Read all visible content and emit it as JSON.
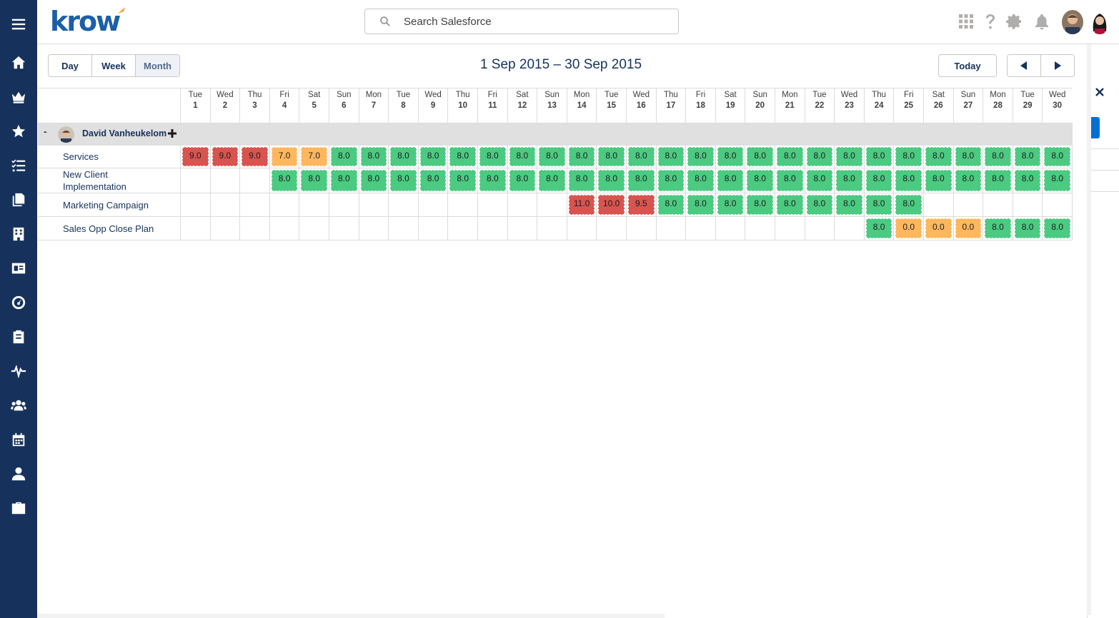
{
  "brand": {
    "logo_text": "krow",
    "accent": "#f59a23",
    "primary": "#1b5fa8"
  },
  "search": {
    "placeholder": "Search Salesforce"
  },
  "sidebar": {
    "items": [
      {
        "icon": "menu-icon"
      },
      {
        "icon": "home-icon"
      },
      {
        "icon": "crown-icon"
      },
      {
        "icon": "star-icon"
      },
      {
        "icon": "task-list-icon"
      },
      {
        "icon": "files-icon"
      },
      {
        "icon": "building-icon"
      },
      {
        "icon": "contact-card-icon"
      },
      {
        "icon": "dashboard-gauge-icon"
      },
      {
        "icon": "clipboard-icon"
      },
      {
        "icon": "pulse-icon"
      },
      {
        "icon": "group-icon"
      },
      {
        "icon": "calendar-icon"
      },
      {
        "icon": "person-icon"
      },
      {
        "icon": "briefcase-icon"
      }
    ]
  },
  "toolbar": {
    "views": [
      "Day",
      "Week",
      "Month"
    ],
    "active_view": "Month",
    "date_range": "1 Sep 2015 – 30 Sep 2015",
    "today_label": "Today"
  },
  "grid": {
    "days": [
      {
        "dow": "Tue",
        "num": "1"
      },
      {
        "dow": "Wed",
        "num": "2"
      },
      {
        "dow": "Thu",
        "num": "3"
      },
      {
        "dow": "Fri",
        "num": "4"
      },
      {
        "dow": "Sat",
        "num": "5"
      },
      {
        "dow": "Sun",
        "num": "6"
      },
      {
        "dow": "Mon",
        "num": "7"
      },
      {
        "dow": "Tue",
        "num": "8"
      },
      {
        "dow": "Wed",
        "num": "9"
      },
      {
        "dow": "Thu",
        "num": "10"
      },
      {
        "dow": "Fri",
        "num": "11"
      },
      {
        "dow": "Sat",
        "num": "12"
      },
      {
        "dow": "Sun",
        "num": "13"
      },
      {
        "dow": "Mon",
        "num": "14"
      },
      {
        "dow": "Tue",
        "num": "15"
      },
      {
        "dow": "Wed",
        "num": "16"
      },
      {
        "dow": "Thu",
        "num": "17"
      },
      {
        "dow": "Fri",
        "num": "18"
      },
      {
        "dow": "Sat",
        "num": "19"
      },
      {
        "dow": "Sun",
        "num": "20"
      },
      {
        "dow": "Mon",
        "num": "21"
      },
      {
        "dow": "Tue",
        "num": "22"
      },
      {
        "dow": "Wed",
        "num": "23"
      },
      {
        "dow": "Thu",
        "num": "24"
      },
      {
        "dow": "Fri",
        "num": "25"
      },
      {
        "dow": "Sat",
        "num": "26"
      },
      {
        "dow": "Sun",
        "num": "27"
      },
      {
        "dow": "Mon",
        "num": "28"
      },
      {
        "dow": "Tue",
        "num": "29"
      },
      {
        "dow": "Wed",
        "num": "30"
      }
    ],
    "person": {
      "name": "David Vanheukelom",
      "toggle": "-"
    },
    "status_colors": {
      "green": "#4bca81",
      "red": "#d9534f",
      "orange": "#ffb75d"
    },
    "projects": [
      {
        "label": "Services",
        "cells": [
          [
            "9.0",
            "red"
          ],
          [
            "9.0",
            "red"
          ],
          [
            "9.0",
            "red"
          ],
          [
            "7.0",
            "orange"
          ],
          [
            "7.0",
            "orange"
          ],
          [
            "8.0",
            "green"
          ],
          [
            "8.0",
            "green"
          ],
          [
            "8.0",
            "green"
          ],
          [
            "8.0",
            "green"
          ],
          [
            "8.0",
            "green"
          ],
          [
            "8.0",
            "green"
          ],
          [
            "8.0",
            "green"
          ],
          [
            "8.0",
            "green"
          ],
          [
            "8.0",
            "green"
          ],
          [
            "8.0",
            "green"
          ],
          [
            "8.0",
            "green"
          ],
          [
            "8.0",
            "green"
          ],
          [
            "8.0",
            "green"
          ],
          [
            "8.0",
            "green"
          ],
          [
            "8.0",
            "green"
          ],
          [
            "8.0",
            "green"
          ],
          [
            "8.0",
            "green"
          ],
          [
            "8.0",
            "green"
          ],
          [
            "8.0",
            "green"
          ],
          [
            "8.0",
            "green"
          ],
          [
            "8.0",
            "green"
          ],
          [
            "8.0",
            "green"
          ],
          [
            "8.0",
            "green"
          ],
          [
            "8.0",
            "green"
          ],
          [
            "8.0",
            "green"
          ]
        ]
      },
      {
        "label": "New Client Implementation",
        "cells": [
          null,
          null,
          null,
          [
            "8.0",
            "green"
          ],
          [
            "8.0",
            "green"
          ],
          [
            "8.0",
            "green"
          ],
          [
            "8.0",
            "green"
          ],
          [
            "8.0",
            "green"
          ],
          [
            "8.0",
            "green"
          ],
          [
            "8.0",
            "green"
          ],
          [
            "8.0",
            "green"
          ],
          [
            "8.0",
            "green"
          ],
          [
            "8.0",
            "green"
          ],
          [
            "8.0",
            "green"
          ],
          [
            "8.0",
            "green"
          ],
          [
            "8.0",
            "green"
          ],
          [
            "8.0",
            "green"
          ],
          [
            "8.0",
            "green"
          ],
          [
            "8.0",
            "green"
          ],
          [
            "8.0",
            "green"
          ],
          [
            "8.0",
            "green"
          ],
          [
            "8.0",
            "green"
          ],
          [
            "8.0",
            "green"
          ],
          [
            "8.0",
            "green"
          ],
          [
            "8.0",
            "green"
          ],
          [
            "8.0",
            "green"
          ],
          [
            "8.0",
            "green"
          ],
          [
            "8.0",
            "green"
          ],
          [
            "8.0",
            "green"
          ],
          [
            "8.0",
            "green"
          ]
        ]
      },
      {
        "label": "Marketing Campaign",
        "cells": [
          null,
          null,
          null,
          null,
          null,
          null,
          null,
          null,
          null,
          null,
          null,
          null,
          null,
          [
            "11.0",
            "red"
          ],
          [
            "10.0",
            "red"
          ],
          [
            "9.5",
            "red"
          ],
          [
            "8.0",
            "green"
          ],
          [
            "8.0",
            "green"
          ],
          [
            "8.0",
            "green"
          ],
          [
            "8.0",
            "green"
          ],
          [
            "8.0",
            "green"
          ],
          [
            "8.0",
            "green"
          ],
          [
            "8.0",
            "green"
          ],
          [
            "8.0",
            "green"
          ],
          [
            "8.0",
            "green"
          ],
          null,
          null,
          null,
          null,
          null
        ]
      },
      {
        "label": "Sales Opp Close Plan",
        "cells": [
          null,
          null,
          null,
          null,
          null,
          null,
          null,
          null,
          null,
          null,
          null,
          null,
          null,
          null,
          null,
          null,
          null,
          null,
          null,
          null,
          null,
          null,
          null,
          [
            "8.0",
            "green"
          ],
          [
            "0.0",
            "orange"
          ],
          [
            "0.0",
            "orange"
          ],
          [
            "0.0",
            "orange"
          ],
          [
            "8.0",
            "green"
          ],
          [
            "8.0",
            "green"
          ],
          [
            "8.0",
            "green"
          ]
        ]
      }
    ]
  }
}
